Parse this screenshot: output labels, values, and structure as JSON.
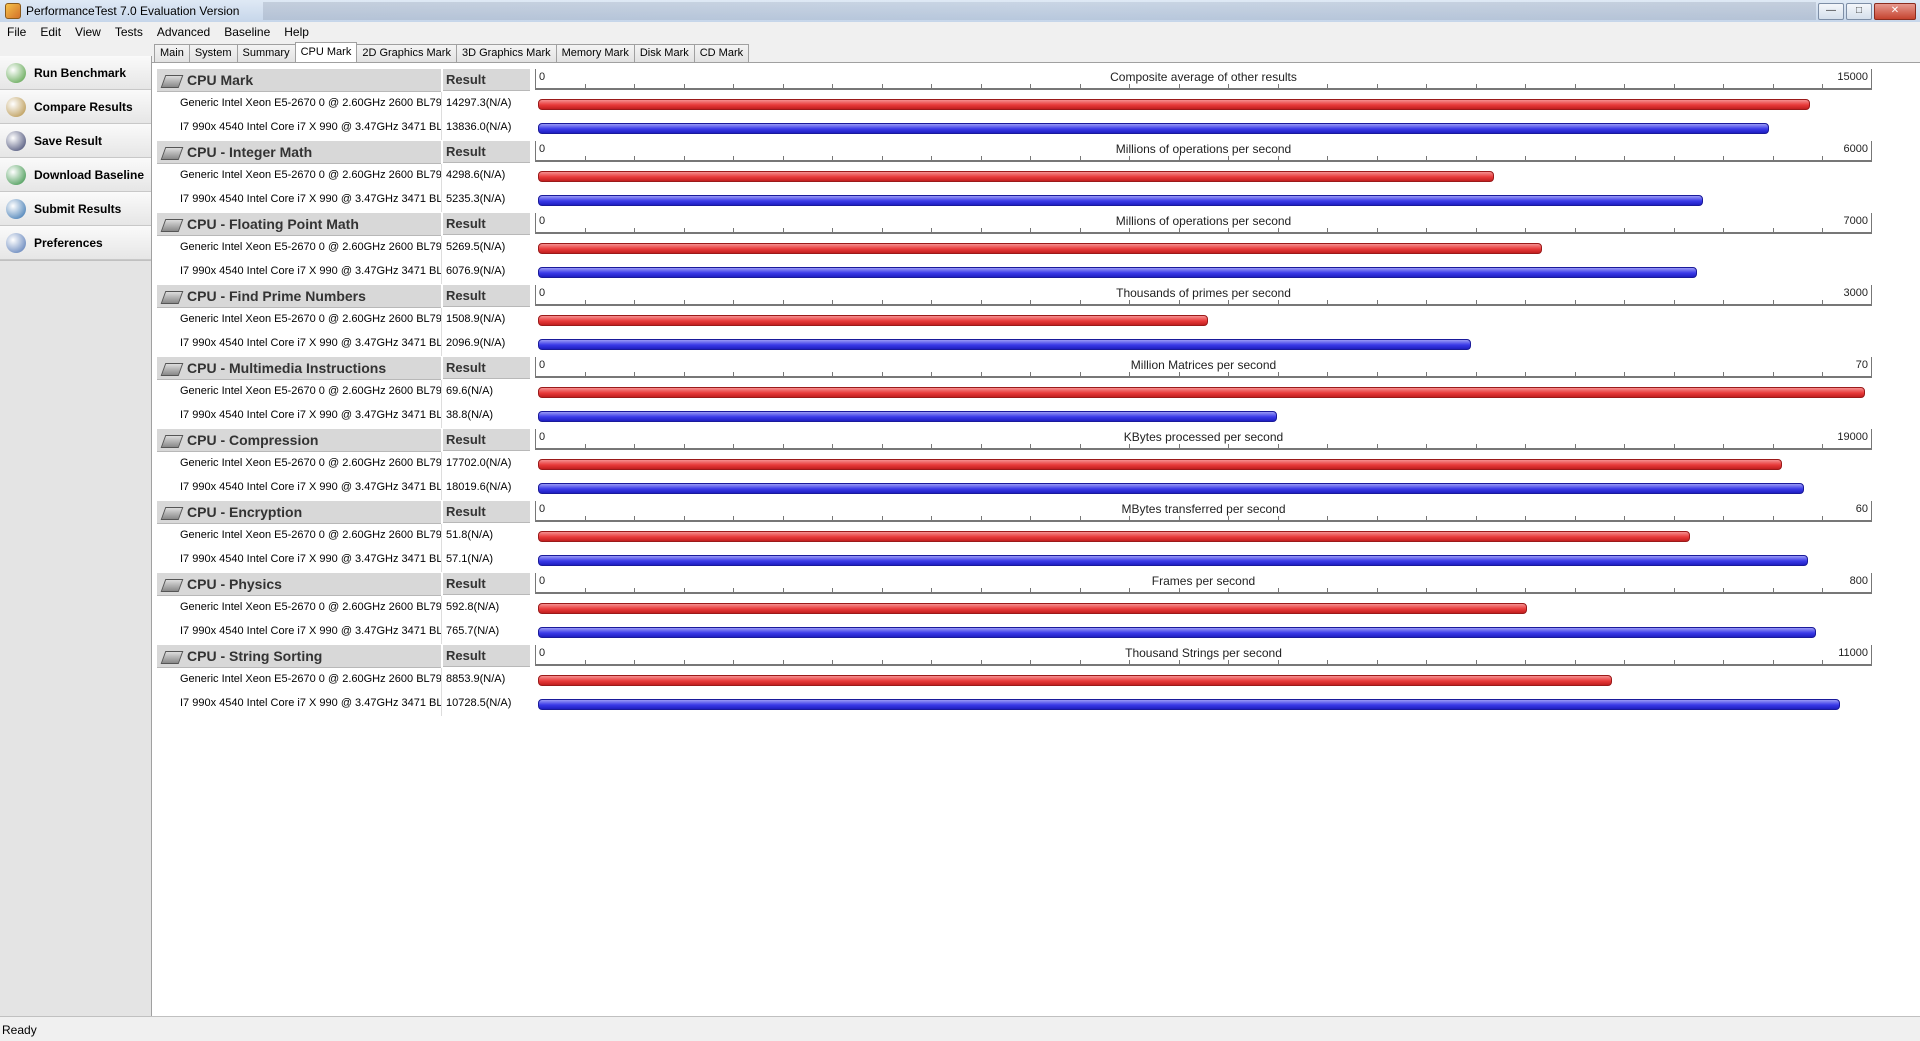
{
  "window": {
    "title": "PerformanceTest 7.0 Evaluation Version"
  },
  "menu": [
    "File",
    "Edit",
    "View",
    "Tests",
    "Advanced",
    "Baseline",
    "Help"
  ],
  "sidebar": [
    {
      "label": "Run Benchmark",
      "icon": "run-benchmark-icon",
      "color": "#4a9a3a"
    },
    {
      "label": "Compare Results",
      "icon": "scales-icon",
      "color": "#b08a3a"
    },
    {
      "label": "Save Result",
      "icon": "floppy-disk-icon",
      "color": "#333a66"
    },
    {
      "label": "Download Baseline",
      "icon": "globe-download-icon",
      "color": "#2a8a3a"
    },
    {
      "label": "Submit Results",
      "icon": "globe-upload-icon",
      "color": "#2a6aaa"
    },
    {
      "label": "Preferences",
      "icon": "clipboard-icon",
      "color": "#4a70b0"
    }
  ],
  "tabs": [
    {
      "label": "Main",
      "active": false
    },
    {
      "label": "System",
      "active": false
    },
    {
      "label": "Summary",
      "active": false
    },
    {
      "label": "CPU Mark",
      "active": true
    },
    {
      "label": "2D Graphics Mark",
      "active": false
    },
    {
      "label": "3D Graphics Mark",
      "active": false
    },
    {
      "label": "Memory Mark",
      "active": false
    },
    {
      "label": "Disk Mark",
      "active": false
    },
    {
      "label": "CD Mark",
      "active": false
    }
  ],
  "result_header": "Result",
  "colors": {
    "series_a": "#e83a3a",
    "series_b": "#3a3ae8"
  },
  "sections": [
    {
      "name": "CPU Mark",
      "unit": "Composite average of other results",
      "min": "0",
      "max": "15000",
      "rows": [
        {
          "name": "Generic Intel Xeon E5-2670 0 @ 2.60GHz 2600 BL79...",
          "result": "14297.3(N/A)",
          "value": 14297.3,
          "series": "red"
        },
        {
          "name": "I7 990x 4540 Intel Core i7 X 990 @ 3.47GHz 3471 BL...",
          "result": "13836.0(N/A)",
          "value": 13836.0,
          "series": "blue"
        }
      ]
    },
    {
      "name": "CPU - Integer Math",
      "unit": "Millions of operations per second",
      "min": "0",
      "max": "6000",
      "rows": [
        {
          "name": "Generic Intel Xeon E5-2670 0 @ 2.60GHz 2600 BL79...",
          "result": "4298.6(N/A)",
          "value": 4298.6,
          "series": "red"
        },
        {
          "name": "I7 990x 4540 Intel Core i7 X 990 @ 3.47GHz 3471 BL...",
          "result": "5235.3(N/A)",
          "value": 5235.3,
          "series": "blue"
        }
      ]
    },
    {
      "name": "CPU - Floating Point Math",
      "unit": "Millions of operations per second",
      "min": "0",
      "max": "7000",
      "rows": [
        {
          "name": "Generic Intel Xeon E5-2670 0 @ 2.60GHz 2600 BL79...",
          "result": "5269.5(N/A)",
          "value": 5269.5,
          "series": "red"
        },
        {
          "name": "I7 990x 4540 Intel Core i7 X 990 @ 3.47GHz 3471 BL...",
          "result": "6076.9(N/A)",
          "value": 6076.9,
          "series": "blue"
        }
      ]
    },
    {
      "name": "CPU - Find Prime Numbers",
      "unit": "Thousands of primes per second",
      "min": "0",
      "max": "3000",
      "rows": [
        {
          "name": "Generic Intel Xeon E5-2670 0 @ 2.60GHz 2600 BL79...",
          "result": "1508.9(N/A)",
          "value": 1508.9,
          "series": "red"
        },
        {
          "name": "I7 990x 4540 Intel Core i7 X 990 @ 3.47GHz 3471 BL...",
          "result": "2096.9(N/A)",
          "value": 2096.9,
          "series": "blue"
        }
      ]
    },
    {
      "name": "CPU - Multimedia Instructions",
      "unit": "Million Matrices per second",
      "min": "0",
      "max": "70",
      "rows": [
        {
          "name": "Generic Intel Xeon E5-2670 0 @ 2.60GHz 2600 BL79...",
          "result": "69.6(N/A)",
          "value": 69.6,
          "series": "red"
        },
        {
          "name": "I7 990x 4540 Intel Core i7 X 990 @ 3.47GHz 3471 BL...",
          "result": "38.8(N/A)",
          "value": 38.8,
          "series": "blue"
        }
      ]
    },
    {
      "name": "CPU - Compression",
      "unit": "KBytes processed per second",
      "min": "0",
      "max": "19000",
      "rows": [
        {
          "name": "Generic Intel Xeon E5-2670 0 @ 2.60GHz 2600 BL79...",
          "result": "17702.0(N/A)",
          "value": 17702.0,
          "series": "red"
        },
        {
          "name": "I7 990x 4540 Intel Core i7 X 990 @ 3.47GHz 3471 BL...",
          "result": "18019.6(N/A)",
          "value": 18019.6,
          "series": "blue"
        }
      ]
    },
    {
      "name": "CPU - Encryption",
      "unit": "MBytes transferred per second",
      "min": "0",
      "max": "60",
      "rows": [
        {
          "name": "Generic Intel Xeon E5-2670 0 @ 2.60GHz 2600 BL79...",
          "result": "51.8(N/A)",
          "value": 51.8,
          "series": "red"
        },
        {
          "name": "I7 990x 4540 Intel Core i7 X 990 @ 3.47GHz 3471 BL...",
          "result": "57.1(N/A)",
          "value": 57.1,
          "series": "blue"
        }
      ]
    },
    {
      "name": "CPU - Physics",
      "unit": "Frames per second",
      "min": "0",
      "max": "800",
      "rows": [
        {
          "name": "Generic Intel Xeon E5-2670 0 @ 2.60GHz 2600 BL79...",
          "result": "592.8(N/A)",
          "value": 592.8,
          "series": "red"
        },
        {
          "name": "I7 990x 4540 Intel Core i7 X 990 @ 3.47GHz 3471 BL...",
          "result": "765.7(N/A)",
          "value": 765.7,
          "series": "blue"
        }
      ]
    },
    {
      "name": "CPU - String Sorting",
      "unit": "Thousand Strings per second",
      "min": "0",
      "max": "11000",
      "rows": [
        {
          "name": "Generic Intel Xeon E5-2670 0 @ 2.60GHz 2600 BL79...",
          "result": "8853.9(N/A)",
          "value": 8853.9,
          "series": "red"
        },
        {
          "name": "I7 990x 4540 Intel Core i7 X 990 @ 3.47GHz 3471 BL...",
          "result": "10728.5(N/A)",
          "value": 10728.5,
          "series": "blue"
        }
      ]
    }
  ],
  "status": "Ready"
}
